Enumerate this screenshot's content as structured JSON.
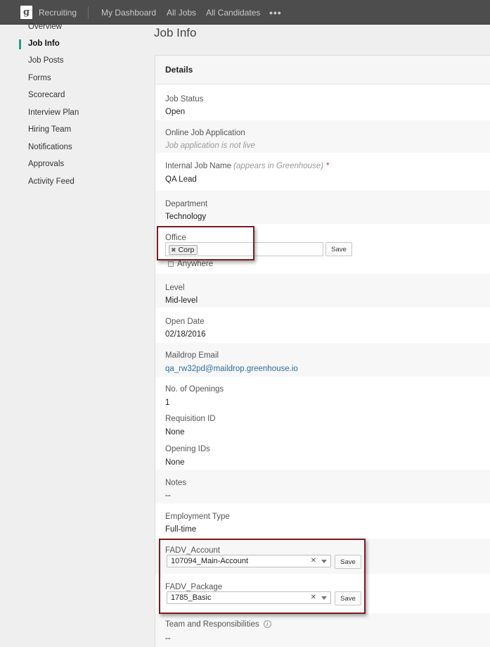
{
  "topbar": {
    "logo": "g",
    "app_name": "Recruiting",
    "nav": [
      "My Dashboard",
      "All Jobs",
      "All Candidates"
    ],
    "more": "•••"
  },
  "sidebar": {
    "items": [
      {
        "label": "Overview",
        "active": false
      },
      {
        "label": "Job Info",
        "active": true
      },
      {
        "label": "Job Posts",
        "active": false
      },
      {
        "label": "Forms",
        "active": false
      },
      {
        "label": "Scorecard",
        "active": false
      },
      {
        "label": "Interview Plan",
        "active": false
      },
      {
        "label": "Hiring Team",
        "active": false
      },
      {
        "label": "Notifications",
        "active": false
      },
      {
        "label": "Approvals",
        "active": false
      },
      {
        "label": "Activity Feed",
        "active": false
      }
    ]
  },
  "page": {
    "title": "Job Info",
    "panel_title": "Details"
  },
  "fields": {
    "job_status": {
      "label": "Job Status",
      "value": "Open"
    },
    "online_app": {
      "label": "Online Job Application",
      "value": "Job application is not live"
    },
    "internal_name": {
      "label": "Internal Job Name",
      "hint": "(appears in Greenhouse)",
      "required": "*",
      "value": "QA Lead"
    },
    "department": {
      "label": "Department",
      "value": "Technology"
    },
    "office": {
      "label": "Office",
      "chip": "Corp",
      "save": "Save",
      "checkbox_label": "Anywhere"
    },
    "level": {
      "label": "Level",
      "value": "Mid-level"
    },
    "open_date": {
      "label": "Open Date",
      "value": "02/18/2016"
    },
    "maildrop": {
      "label": "Maildrop Email",
      "value": "qa_rw32pd@maildrop.greenhouse.io"
    },
    "openings": {
      "label": "No. of Openings",
      "value": "1"
    },
    "requisition": {
      "label": "Requisition ID",
      "value": "None"
    },
    "opening_ids": {
      "label": "Opening IDs",
      "value": "None"
    },
    "notes": {
      "label": "Notes",
      "value": "--"
    },
    "employment": {
      "label": "Employment Type",
      "value": "Full-time"
    },
    "fadv_account": {
      "label": "FADV_Account",
      "value": "107094_Main-Account",
      "save": "Save"
    },
    "fadv_package": {
      "label": "FADV_Package",
      "value": "1785_Basic",
      "save": "Save"
    },
    "team": {
      "label": "Team and Responsibilities",
      "value": "--"
    }
  },
  "colors": {
    "topbar": "#4d4d4d",
    "accent": "#2a9d86",
    "link": "#2a6ea5",
    "callout": "#7a1e22",
    "required": "#b03a5b"
  }
}
